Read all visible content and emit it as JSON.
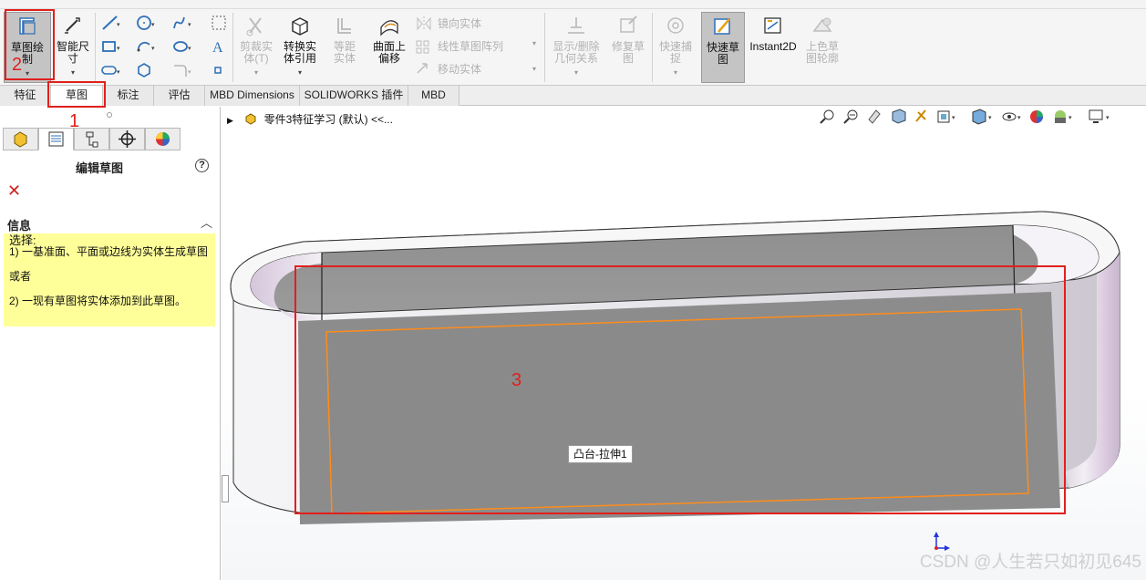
{
  "ribbon": {
    "sketch_btn": "草图绘制",
    "smart_dim_btn": "智能尺寸",
    "trim_btn": "剪裁实体(T)",
    "convert_btn": "转换实体引用",
    "offset_btn": "等距实体",
    "surface_offset_btn": "曲面上偏移",
    "mirror_item": "镜向实体",
    "linear_pattern_item": "线性草图阵列",
    "move_item": "移动实体",
    "display_rel_btn": "显示/删除几何关系",
    "repair_btn": "修复草图",
    "snap_btn": "快速捕捉",
    "rapid_sketch_btn": "快速草图",
    "instant2d_btn": "Instant2D",
    "shaded_btn": "上色草图轮廓"
  },
  "tabs": [
    "特征",
    "草图",
    "标注",
    "评估",
    "MBD Dimensions",
    "SOLIDWORKS 插件",
    "MBD"
  ],
  "panel": {
    "title": "编辑草图",
    "help": "?",
    "close": "✕",
    "info_header": "信息",
    "info_lines": [
      "选择:",
      "1) 一基准面、平面或边线为实体生成草图",
      "",
      "或者",
      "",
      "2) 一现有草图将实体添加到此草图。"
    ]
  },
  "viewport": {
    "tree_label": "零件3特征学习 (默认) <<...",
    "tooltip": "凸台-拉伸1",
    "watermark": "CSDN @人生若只如初见645"
  },
  "annotations": [
    "1",
    "2",
    "3"
  ],
  "colors": {
    "annotation": "#e0201d",
    "sketch_face_edge": "#ff8c1a",
    "info_bg": "#ffff99",
    "model_face": "#8c8c8c"
  }
}
